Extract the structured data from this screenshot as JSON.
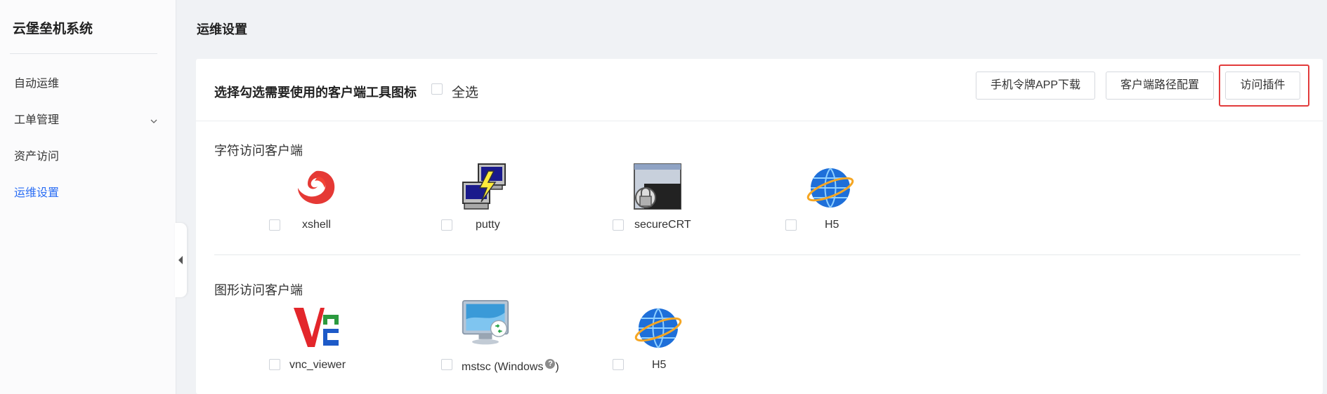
{
  "sidebar": {
    "app_title": "云堡垒机系统",
    "items": [
      {
        "label": "自动运维",
        "active": false
      },
      {
        "label": "工单管理",
        "active": false,
        "expandable": true
      },
      {
        "label": "资产访问",
        "active": false
      },
      {
        "label": "运维设置",
        "active": true
      }
    ]
  },
  "page": {
    "title": "运维设置"
  },
  "panel": {
    "header_title": "选择勾选需要使用的客户端工具图标",
    "select_all_label": "全选",
    "buttons": {
      "app_download": "手机令牌APP下载",
      "client_path": "客户端路径配置",
      "access_plugin": "访问插件"
    },
    "sections": [
      {
        "title": "字符访问客户端",
        "clients": [
          {
            "label": "xshell",
            "icon": "xshell-icon"
          },
          {
            "label": "putty",
            "icon": "putty-icon"
          },
          {
            "label": "secureCRT",
            "icon": "securecrt-icon"
          },
          {
            "label": "H5",
            "icon": "globe-icon"
          }
        ]
      },
      {
        "title": "图形访问客户端",
        "clients": [
          {
            "label": "vnc_viewer",
            "icon": "vnc-icon"
          },
          {
            "label": "mstsc (Windows",
            "label_suffix": ")",
            "help": "?",
            "icon": "mstsc-icon"
          },
          {
            "label": "H5",
            "icon": "globe-icon"
          }
        ]
      }
    ]
  },
  "colors": {
    "accent": "#2a6df4",
    "highlight": "#e23b3b",
    "background": "#f0f2f5"
  }
}
